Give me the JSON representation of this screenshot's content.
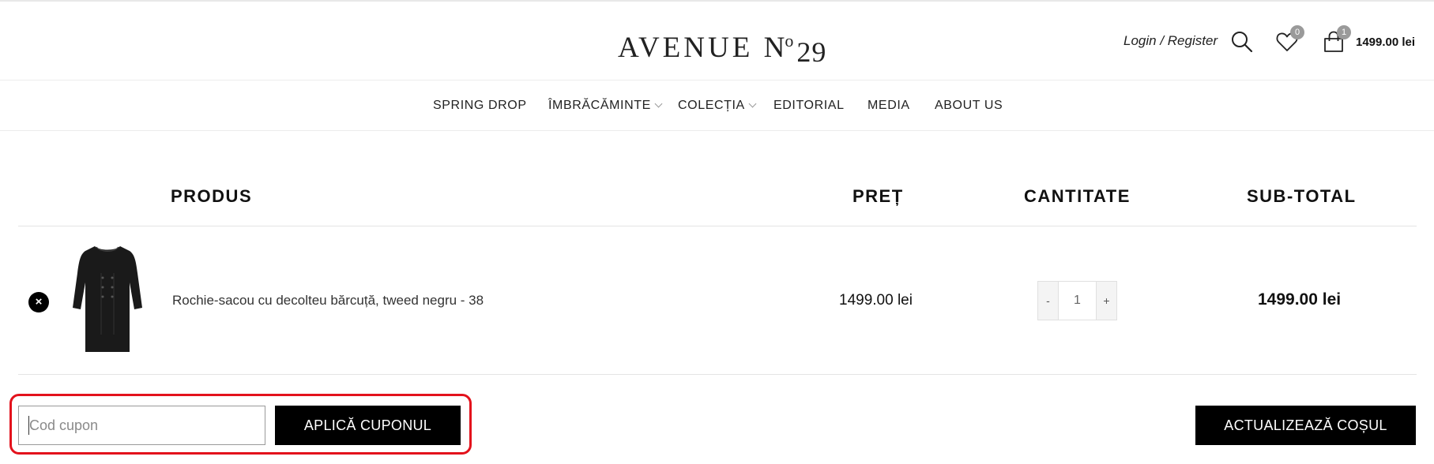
{
  "header": {
    "logo": {
      "word": "AVENUE",
      "no_symbol": "N",
      "no_sup": "o",
      "number": "29"
    },
    "login_label": "Login / Register",
    "wishlist_count": "0",
    "cart_count": "1",
    "cart_total": "1499.00 lei",
    "icons": {
      "search": "search-icon",
      "wishlist": "heart-icon",
      "cart": "shopping-bag-icon"
    }
  },
  "nav": {
    "items": [
      {
        "label": "SPRING DROP",
        "has_dropdown": false
      },
      {
        "label": "ÎMBRĂCĂMINTE",
        "has_dropdown": true
      },
      {
        "label": "COLECȚIA",
        "has_dropdown": true
      },
      {
        "label": "EDITORIAL",
        "has_dropdown": false
      },
      {
        "label": "MEDIA",
        "has_dropdown": false
      },
      {
        "label": "ABOUT US",
        "has_dropdown": false
      }
    ]
  },
  "cart_table": {
    "headers": {
      "product": "PRODUS",
      "price": "PREȚ",
      "quantity": "CANTITATE",
      "subtotal": "SUB-TOTAL"
    },
    "rows": [
      {
        "name": "Rochie-sacou cu decolteu bărcuță, tweed negru - 38",
        "price": "1499.00 lei",
        "qty_minus": "-",
        "quantity": "1",
        "qty_plus": "+",
        "subtotal": "1499.00 lei",
        "remove_icon": "×"
      }
    ]
  },
  "coupon": {
    "placeholder": "Cod cupon",
    "value": "",
    "apply_label": "APLICĂ CUPONUL"
  },
  "actions": {
    "update_label": "ACTUALIZEAZĂ COȘUL"
  },
  "colors": {
    "accent": "#000000",
    "highlight": "#e3121c",
    "badge": "#9a9a9a",
    "rule": "#e4e4e4"
  }
}
